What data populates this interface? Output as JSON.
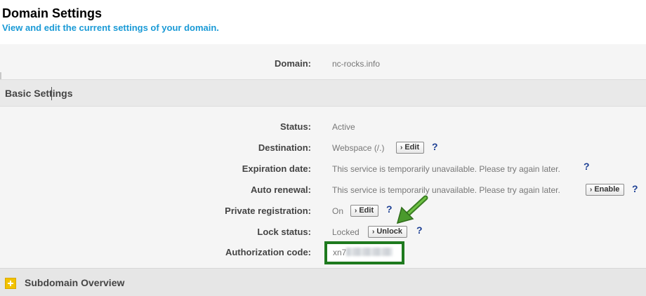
{
  "header": {
    "title": "Domain Settings",
    "subtitle": "View and edit the current settings of your domain."
  },
  "domain": {
    "label": "Domain:",
    "value": "nc-rocks.info"
  },
  "basic_settings": {
    "title": "Basic Settings",
    "rows": {
      "status": {
        "label": "Status:",
        "value": "Active"
      },
      "destination": {
        "label": "Destination:",
        "value": "Webspace (/.)",
        "button": "Edit"
      },
      "expiration": {
        "label": "Expiration date:",
        "value": "This service is temporarily unavailable. Please try again later."
      },
      "auto_renewal": {
        "label": "Auto renewal:",
        "value": "This service is temporarily unavailable. Please try again later.",
        "button": "Enable"
      },
      "private_registration": {
        "label": "Private registration:",
        "value": "On",
        "button": "Edit"
      },
      "lock_status": {
        "label": "Lock status:",
        "value": "Locked",
        "button": "Unlock"
      },
      "authorization_code": {
        "label": "Authorization code:",
        "value_prefix": "xn7"
      }
    },
    "help_glyph": "?"
  },
  "subdomain": {
    "title": "Subdomain Overview"
  },
  "colors": {
    "accent_blue": "#1a9ad6",
    "help_blue": "#1c3f94",
    "highlight_green": "#1e7a1e",
    "plus_yellow": "#f2c200"
  }
}
